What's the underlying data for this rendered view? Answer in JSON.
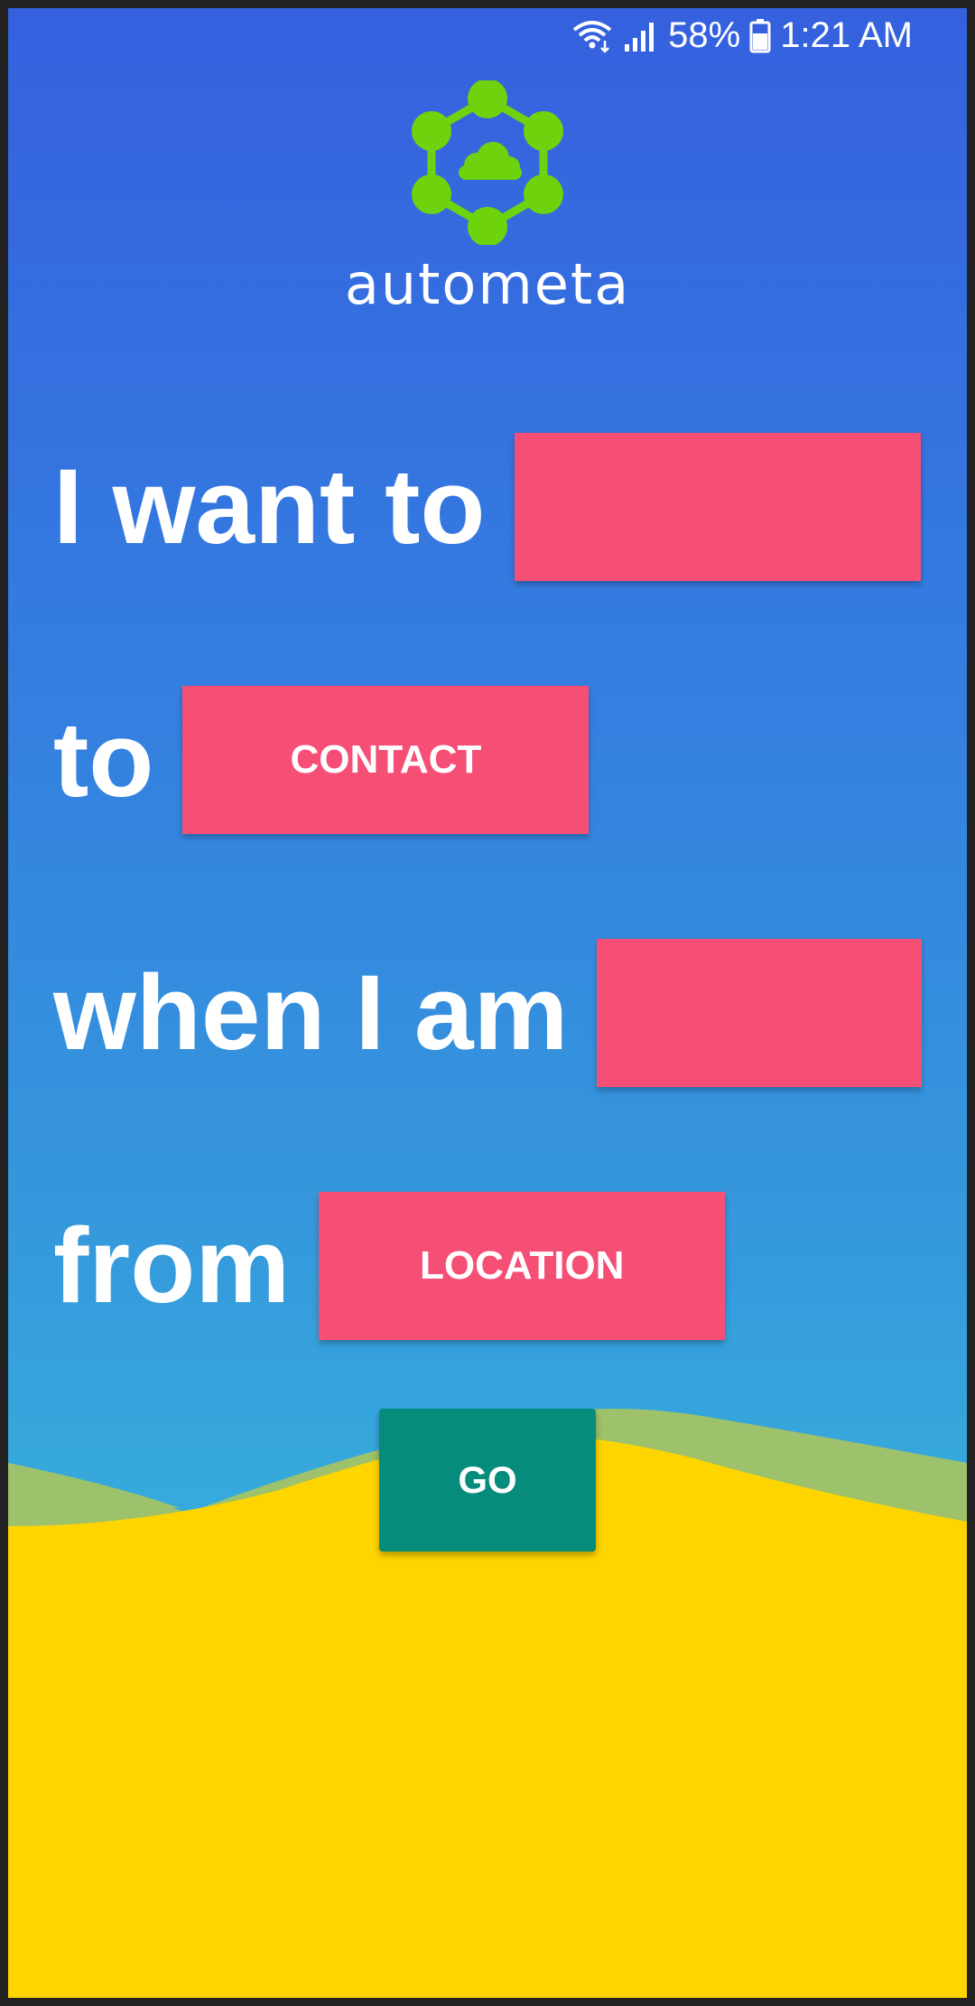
{
  "status_bar": {
    "battery": "58%",
    "time": "1:21 AM",
    "icons": [
      "wifi-icon",
      "signal-icon",
      "battery-icon"
    ]
  },
  "logo": {
    "name": "autometa",
    "icon": "network-cloud-icon",
    "color": "#6ed20c"
  },
  "sentence": {
    "row1_text": "I want to",
    "row1_slot": "",
    "row2_text": "to",
    "row2_slot": "CONTACT",
    "row3_text": "when I am",
    "row3_slot": "",
    "row4_text": "from",
    "row4_slot": "LOCATION"
  },
  "go_button": {
    "label": "GO"
  },
  "colors": {
    "slot": "#f64f76",
    "go_button": "#058c7a",
    "ground": "#ffd500",
    "hill": "#9dc26b",
    "sky_top": "#3560de",
    "sky_bottom": "#37b0da"
  }
}
